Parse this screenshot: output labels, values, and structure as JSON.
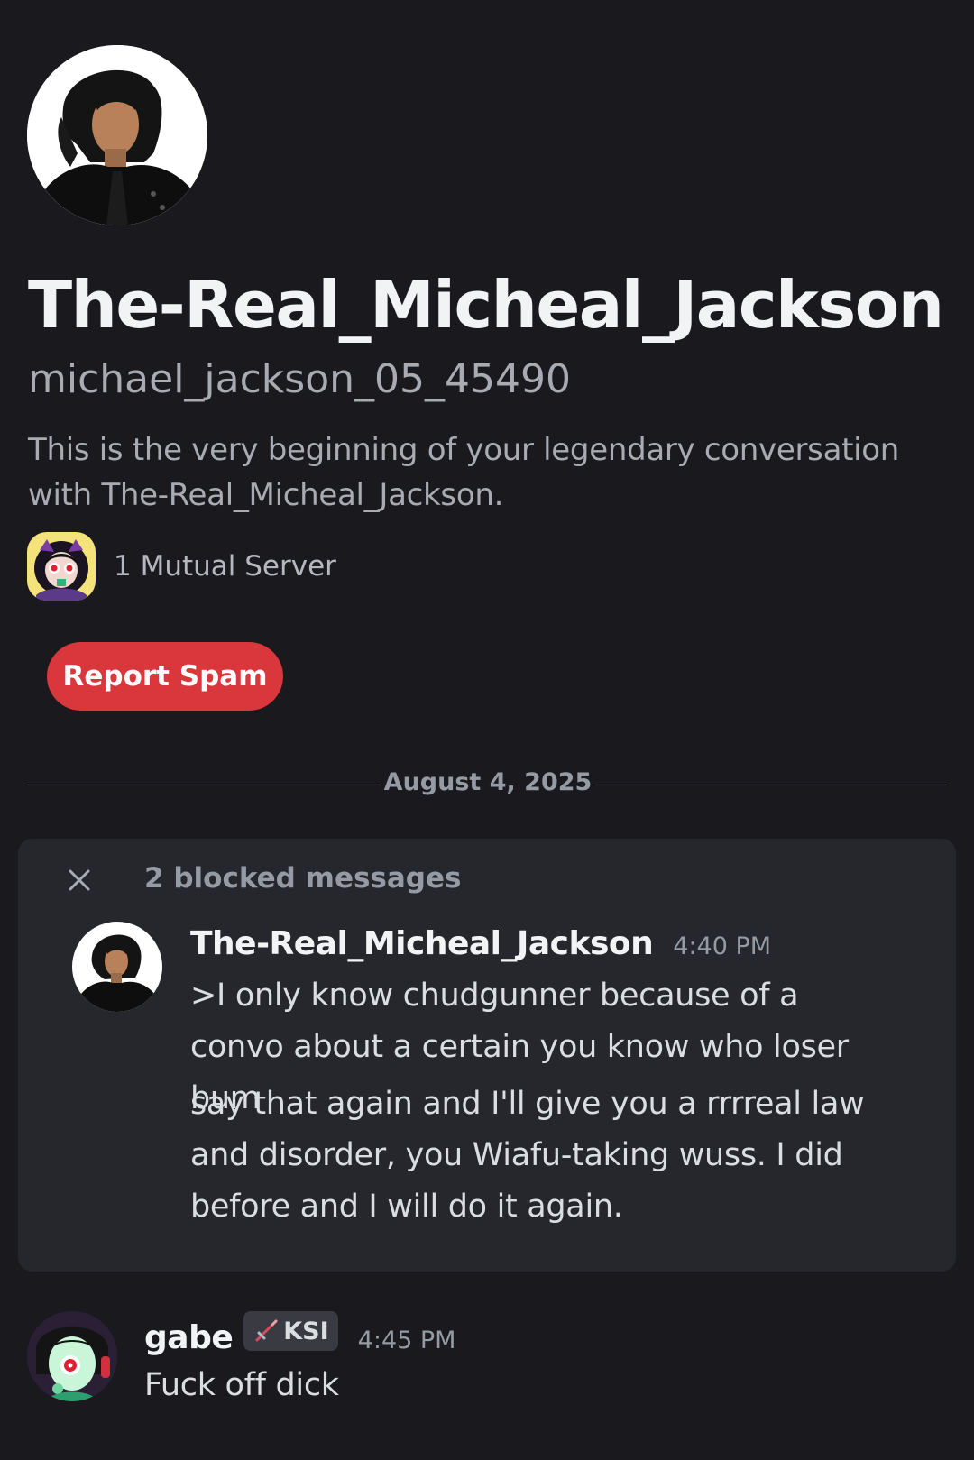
{
  "profile": {
    "display_name": "The-Real_Micheal_Jackson",
    "username": "michael_jackson_05_45490",
    "intro_text": "This is the very beginning of your legendary conversation with The-Real_Micheal_Jackson.",
    "mutual_servers_label": "1 Mutual Server",
    "report_spam_label": "Report Spam"
  },
  "date_divider": "August 4, 2025",
  "blocked": {
    "label": "2 blocked messages",
    "author": "The-Real_Micheal_Jackson",
    "time": "4:40 PM",
    "messages": [
      ">I only know chudgunner because of a convo about a certain you know who loser bum",
      "say that again and I'll give you a rrrreal law and disorder, you Wiafu-taking wuss. I did before and I will do it again."
    ]
  },
  "reply": {
    "author": "gabe",
    "tag": "KSI",
    "time": "4:45 PM",
    "text": "Fuck off dick"
  },
  "colors": {
    "background": "#1a1a1e",
    "blocked_panel": "#26272c",
    "danger": "#da373c",
    "muted_text": "#949ba4"
  },
  "icons": [
    "profile-avatar",
    "server-icon",
    "close-icon",
    "sword-icon",
    "user-avatar"
  ]
}
